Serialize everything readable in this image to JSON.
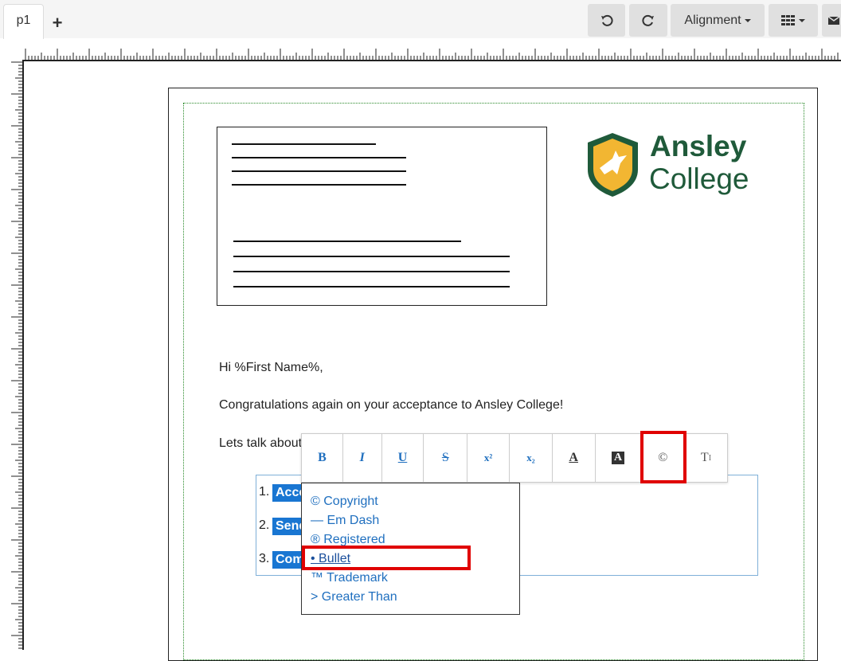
{
  "tabs": {
    "active": "p1",
    "add": "+"
  },
  "toolbar": {
    "undo_icon": "↶",
    "redo_icon": "↷",
    "alignment_label": "Alignment",
    "grid_icon": "grid-icon"
  },
  "logo": {
    "line1": "Ansley",
    "line2": "College"
  },
  "letter": {
    "greeting": "Hi %First Name%,",
    "congrats": "Congratulations again on your acceptance to Ansley College!",
    "lets_talk": "Lets talk about"
  },
  "list": {
    "items": [
      {
        "num": "1.",
        "text": "Acce"
      },
      {
        "num": "2.",
        "text": "Send"
      },
      {
        "num": "3.",
        "text": "Com"
      }
    ]
  },
  "format_bar": {
    "bold": "B",
    "italic": "I",
    "underline": "U",
    "strike": "S",
    "superscript": "x²",
    "subscript": "x₂",
    "font_color": "A",
    "bg_color": "A",
    "special_chars": "©",
    "clear_format": "T"
  },
  "special_chars_menu": {
    "items": [
      "© Copyright",
      "— Em Dash",
      "® Registered",
      "• Bullet",
      "™ Trademark",
      "> Greater Than"
    ]
  },
  "colors": {
    "accent_blue": "#1f6fbf",
    "selection": "#1976d2",
    "highlight_red": "#e00000",
    "brand_green": "#1f5a3a",
    "brand_gold": "#f2b632"
  }
}
